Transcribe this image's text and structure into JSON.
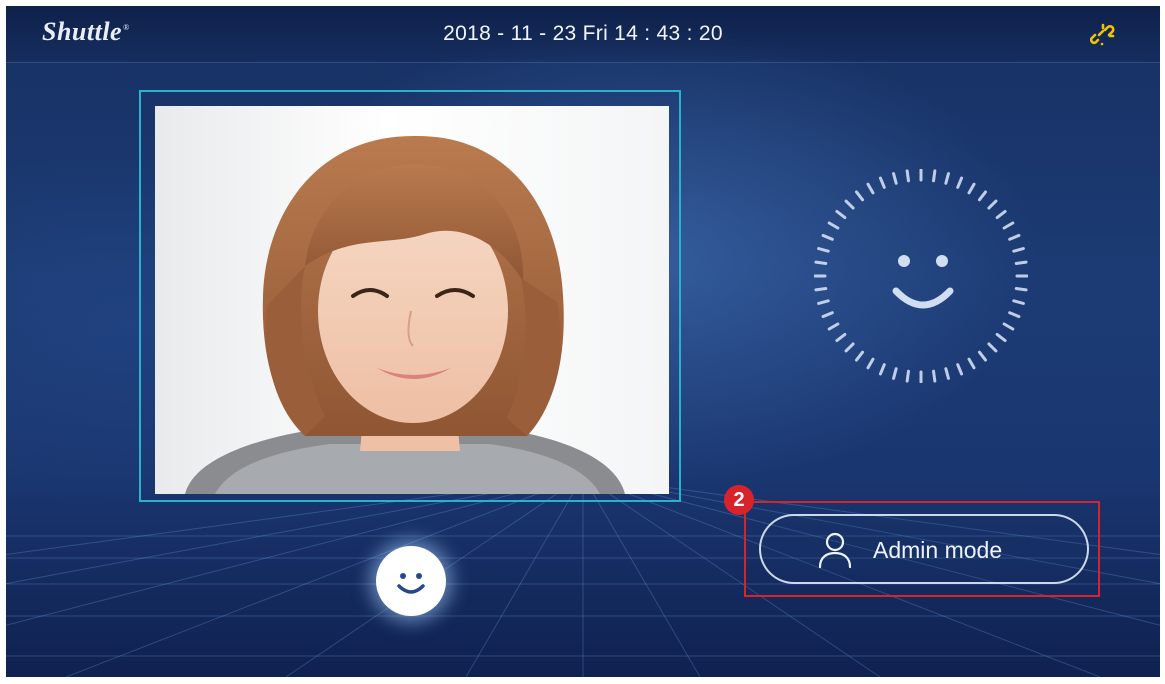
{
  "header": {
    "brand": "Shuttle",
    "brand_mark": "®",
    "datetime": "2018 - 11 - 23  Fri  14 : 43 : 20",
    "status_icon": "link-broken-icon"
  },
  "camera": {
    "icon": "face-photo"
  },
  "face_button": {
    "icon": "smiley-icon"
  },
  "recognition": {
    "icon": "face-scan-icon"
  },
  "admin_button": {
    "label": "Admin mode",
    "icon": "user-icon"
  },
  "callout": {
    "number": "2"
  },
  "colors": {
    "accent_frame": "#29b2cc",
    "callout_red": "#d8232a",
    "link_icon": "#f2c300",
    "background": "#1c3b74"
  }
}
